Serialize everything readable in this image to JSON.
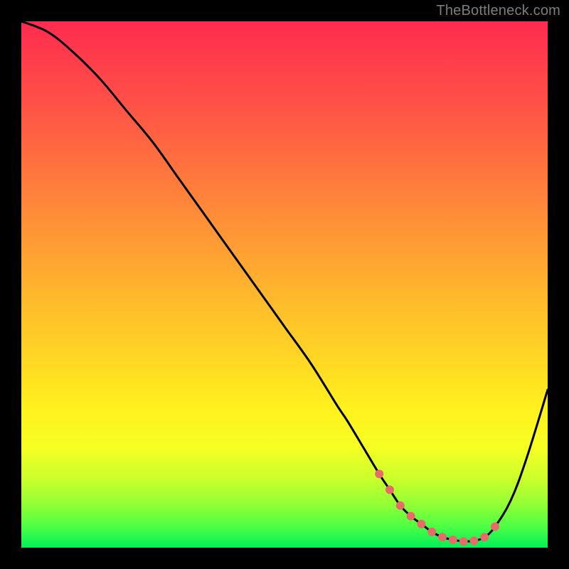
{
  "watermark": "TheBottleneck.com",
  "colors": {
    "page_bg": "#000000",
    "curve": "#000000",
    "marker": "#e86a69",
    "gradient_top": "#ff2b4f",
    "gradient_bottom": "#00f05a"
  },
  "chart_data": {
    "type": "line",
    "title": "",
    "xlabel": "",
    "ylabel": "",
    "xlim": [
      0,
      100
    ],
    "ylim": [
      0,
      100
    ],
    "grid": false,
    "legend": false,
    "series": [
      {
        "name": "bottleneck-curve",
        "x": [
          0,
          5,
          10,
          15,
          20,
          25,
          30,
          35,
          40,
          45,
          50,
          55,
          60,
          62,
          65,
          68,
          70,
          72,
          74,
          76,
          78,
          80,
          82,
          84,
          86,
          88,
          90,
          93,
          96,
          100
        ],
        "y": [
          100,
          98,
          94,
          89,
          83,
          77,
          70,
          63,
          56,
          49,
          42,
          35,
          27,
          24,
          19,
          14,
          11,
          8,
          6,
          4.5,
          3,
          2,
          1.5,
          1.2,
          1.3,
          2,
          4,
          9,
          17,
          30
        ]
      }
    ],
    "annotations": [
      {
        "name": "optimal-range-markers",
        "x": [
          68,
          70,
          72,
          74,
          76,
          78,
          80,
          82,
          84,
          86,
          88,
          90
        ],
        "y": [
          14,
          11,
          8,
          6,
          4.5,
          3,
          2,
          1.5,
          1.2,
          1.3,
          2,
          4
        ]
      }
    ]
  }
}
